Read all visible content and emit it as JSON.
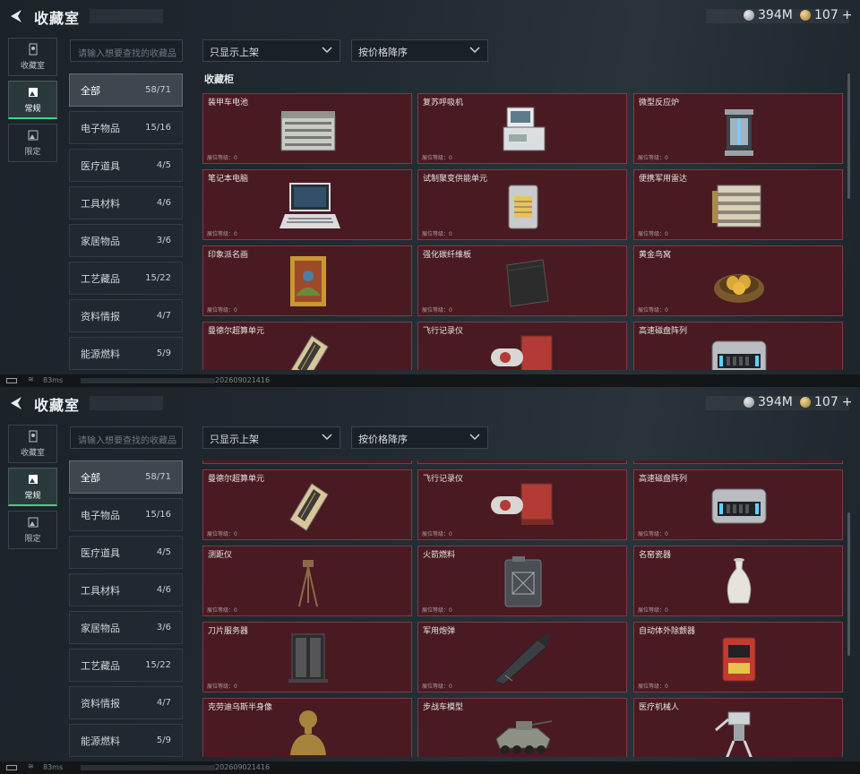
{
  "screens": [
    {
      "title": "收藏室",
      "currency": {
        "silver": "394M",
        "gold": "107",
        "plus": "+"
      },
      "side_tabs": [
        "收藏室",
        "常规",
        "限定"
      ],
      "search_placeholder": "请输入想要查找的收藏品",
      "filter1": "只显示上架",
      "filter2": "按价格降序",
      "categories": [
        {
          "name": "全部",
          "count": "58/71"
        },
        {
          "name": "电子物品",
          "count": "15/16"
        },
        {
          "name": "医疗道具",
          "count": "4/5"
        },
        {
          "name": "工具材料",
          "count": "4/6"
        },
        {
          "name": "家居物品",
          "count": "3/6"
        },
        {
          "name": "工艺藏品",
          "count": "15/22"
        },
        {
          "name": "资料情报",
          "count": "4/7"
        },
        {
          "name": "能源燃料",
          "count": "5/9"
        }
      ],
      "cabinet_label": "收藏柜",
      "items": [
        {
          "name": "装甲车电池",
          "level": "展位等级：0",
          "icon": "battery-icon",
          "color": "#c9ccc4"
        },
        {
          "name": "复苏呼吸机",
          "level": "展位等级：0",
          "icon": "ventilator-icon",
          "color": "#dcdfe0"
        },
        {
          "name": "微型反应炉",
          "level": "展位等级：0",
          "icon": "reactor-icon",
          "color": "#9fb3c0"
        },
        {
          "name": "笔记本电脑",
          "level": "展位等级：0",
          "icon": "laptop-icon",
          "color": "#d9dcdf"
        },
        {
          "name": "试制聚变供能单元",
          "level": "展位等级：0",
          "icon": "fusion-unit-icon",
          "color": "#e9c35a"
        },
        {
          "name": "便携军用雷达",
          "level": "展位等级：0",
          "icon": "radar-icon",
          "color": "#d8d0b8"
        },
        {
          "name": "印象派名画",
          "level": "展位等级：0",
          "icon": "painting-icon",
          "color": "#c8992e"
        },
        {
          "name": "强化碳纤维板",
          "level": "展位等级：0",
          "icon": "carbon-plate-icon",
          "color": "#2c2c2c"
        },
        {
          "name": "黄金鸟窝",
          "level": "展位等级：0",
          "icon": "golden-nest-icon",
          "color": "#d9a93a"
        },
        {
          "name": "曼德尔超算单元",
          "level": "展位等级：0",
          "icon": "compute-unit-icon",
          "color": "#d9c79a"
        },
        {
          "name": "飞行记录仪",
          "level": "展位等级：0",
          "icon": "flight-recorder-icon",
          "color": "#b33a35"
        },
        {
          "name": "高速磁盘阵列",
          "level": "展位等级：0",
          "icon": "disk-array-icon",
          "color": "#b9bcc0"
        }
      ],
      "status": {
        "ping": "83ms",
        "id": "202609021416"
      }
    },
    {
      "title": "收藏室",
      "currency": {
        "silver": "394M",
        "gold": "107",
        "plus": "+"
      },
      "side_tabs": [
        "收藏室",
        "常规",
        "限定"
      ],
      "search_placeholder": "请输入想要查找的收藏品",
      "filter1": "只显示上架",
      "filter2": "按价格降序",
      "categories": [
        {
          "name": "全部",
          "count": "58/71"
        },
        {
          "name": "电子物品",
          "count": "15/16"
        },
        {
          "name": "医疗道具",
          "count": "4/5"
        },
        {
          "name": "工具材料",
          "count": "4/6"
        },
        {
          "name": "家居物品",
          "count": "3/6"
        },
        {
          "name": "工艺藏品",
          "count": "15/22"
        },
        {
          "name": "资料情报",
          "count": "4/7"
        },
        {
          "name": "能源燃料",
          "count": "5/9"
        }
      ],
      "items": [
        {
          "name": "",
          "level": "展位等级：0",
          "icon": "painting-icon",
          "color": "#c8992e"
        },
        {
          "name": "",
          "level": "展位等级：0",
          "icon": "",
          "color": ""
        },
        {
          "name": "",
          "level": "展位等级：0",
          "icon": "",
          "color": ""
        },
        {
          "name": "曼德尔超算单元",
          "level": "展位等级：0",
          "icon": "compute-unit-icon",
          "color": "#d9c79a"
        },
        {
          "name": "飞行记录仪",
          "level": "展位等级：0",
          "icon": "flight-recorder-icon",
          "color": "#b33a35"
        },
        {
          "name": "高速磁盘阵列",
          "level": "展位等级：0",
          "icon": "disk-array-icon",
          "color": "#b9bcc0"
        },
        {
          "name": "测距仪",
          "level": "展位等级：0",
          "icon": "rangefinder-icon",
          "color": "#8a6a48"
        },
        {
          "name": "火箭燃料",
          "level": "展位等级：0",
          "icon": "fuel-can-icon",
          "color": "#4a4f54"
        },
        {
          "name": "名窑瓷器",
          "level": "展位等级：0",
          "icon": "porcelain-vase-icon",
          "color": "#e6e4da"
        },
        {
          "name": "刀片服务器",
          "level": "展位等级：0",
          "icon": "blade-server-icon",
          "color": "#2a2d31"
        },
        {
          "name": "军用炮弹",
          "level": "展位等级：0",
          "icon": "artillery-shell-icon",
          "color": "#3b3f43"
        },
        {
          "name": "自动体外除颤器",
          "level": "展位等级：0",
          "icon": "defibrillator-icon",
          "color": "#c23a30"
        },
        {
          "name": "克劳迪乌斯半身像",
          "level": "展位等级：0",
          "icon": "bust-statue-icon",
          "color": "#a8833e"
        },
        {
          "name": "步战车模型",
          "level": "展位等级：0",
          "icon": "ifv-model-icon",
          "color": "#8d9184"
        },
        {
          "name": "医疗机械人",
          "level": "展位等级：0",
          "icon": "medical-robot-icon",
          "color": "#d0d3d6"
        }
      ],
      "status": {
        "ping": "83ms",
        "id": "202609021416"
      }
    }
  ]
}
